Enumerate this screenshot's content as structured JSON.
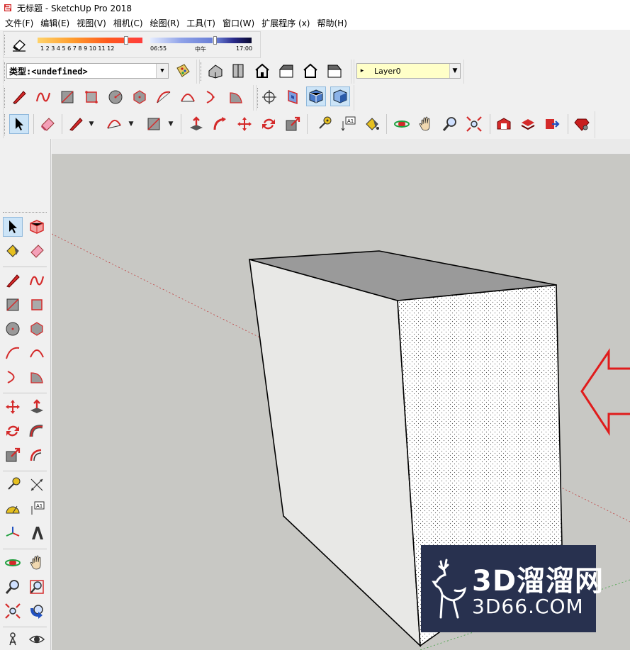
{
  "window": {
    "title": "无标题 - SketchUp Pro 2018"
  },
  "menu": [
    {
      "label": "文件(F)"
    },
    {
      "label": "编辑(E)"
    },
    {
      "label": "视图(V)"
    },
    {
      "label": "相机(C)"
    },
    {
      "label": "绘图(R)"
    },
    {
      "label": "工具(T)"
    },
    {
      "label": "窗口(W)"
    },
    {
      "label": "扩展程序 (x)"
    },
    {
      "label": "帮助(H)"
    }
  ],
  "shadows": {
    "month_ticks": "1 2 3 4 5 6 7 8 9 10 11 12",
    "time_start": "06:55",
    "time_mid": "中午",
    "time_end": "17:00"
  },
  "entity_info": {
    "type_value": "类型:<undefined>"
  },
  "layers": {
    "current": "Layer0"
  },
  "watermark": {
    "brand": "3D溜溜网",
    "url": "3D66.COM"
  },
  "colors": {
    "accent_red": "#d42a2a",
    "viewport_bg": "#c8c8c4",
    "watermark_bg": "#28314f"
  }
}
